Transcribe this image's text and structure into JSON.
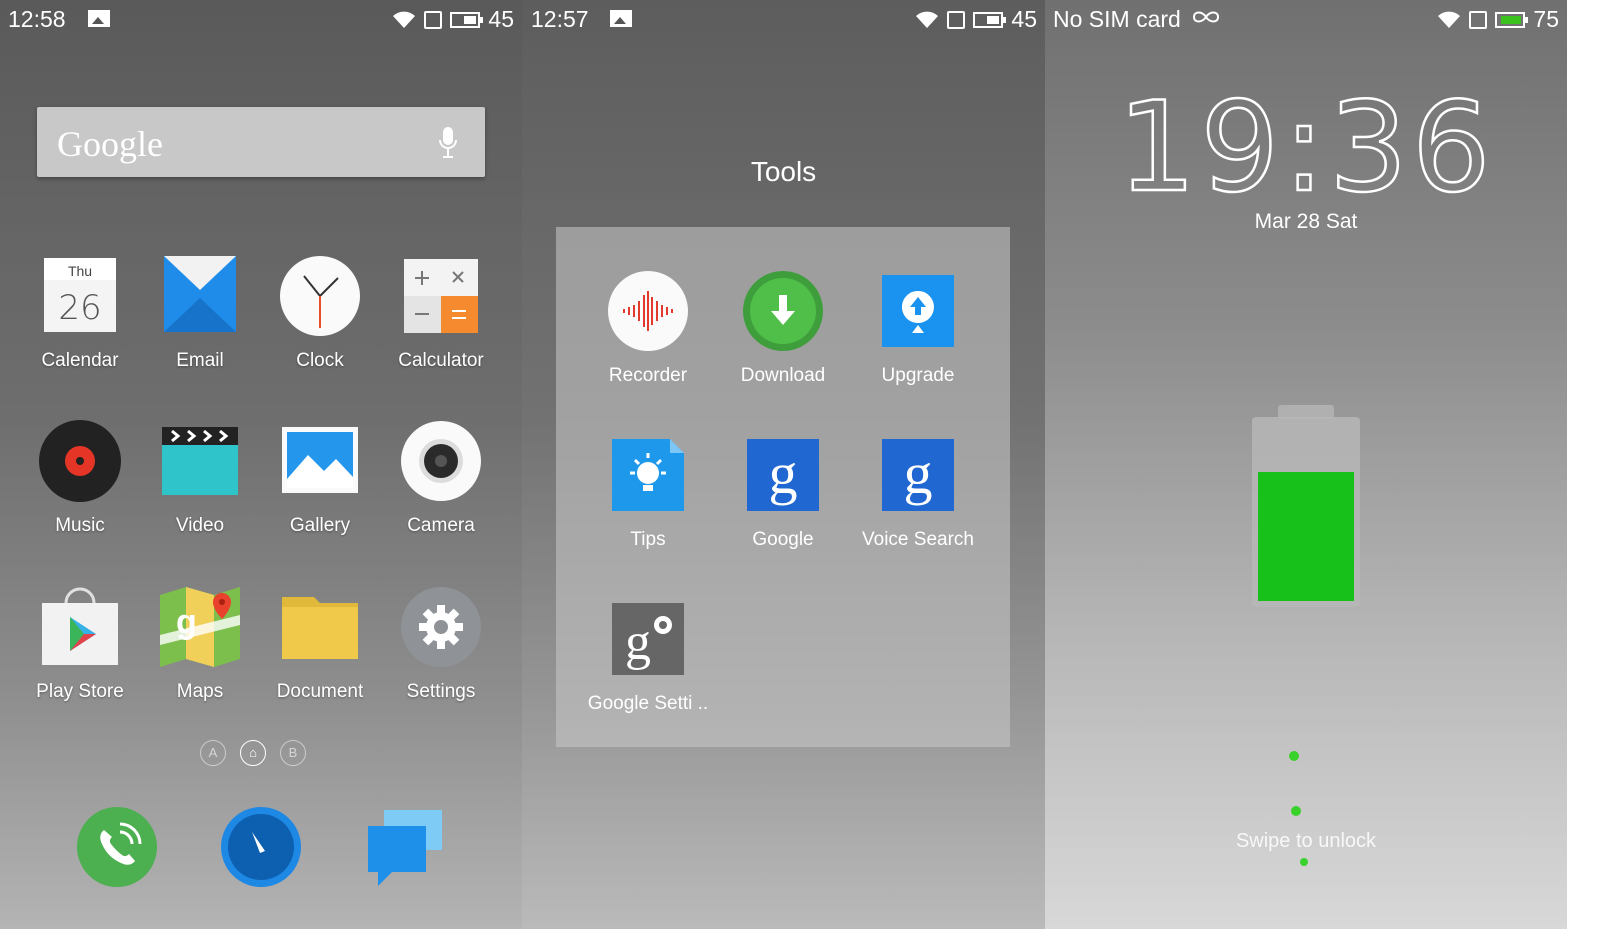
{
  "panel1": {
    "status": {
      "time": "12:58",
      "battery": "45"
    },
    "search": {
      "logo": "Google"
    },
    "apps": [
      {
        "label": "Calendar",
        "icon": "calendar-icon",
        "day": "Thu",
        "date": "26"
      },
      {
        "label": "Email",
        "icon": "email-icon"
      },
      {
        "label": "Clock",
        "icon": "clock-icon"
      },
      {
        "label": "Calculator",
        "icon": "calculator-icon"
      },
      {
        "label": "Music",
        "icon": "music-icon"
      },
      {
        "label": "Video",
        "icon": "video-icon"
      },
      {
        "label": "Gallery",
        "icon": "gallery-icon"
      },
      {
        "label": "Camera",
        "icon": "camera-icon"
      },
      {
        "label": "Play Store",
        "icon": "play-store-icon"
      },
      {
        "label": "Maps",
        "icon": "maps-icon"
      },
      {
        "label": "Document",
        "icon": "document-icon"
      },
      {
        "label": "Settings",
        "icon": "settings-icon"
      }
    ],
    "page_dots": [
      "A",
      "⌂",
      "B"
    ],
    "dock": [
      "phone-icon",
      "browser-icon",
      "messages-icon"
    ]
  },
  "panel2": {
    "status": {
      "time": "12:57",
      "battery": "45"
    },
    "folder": {
      "title": "Tools",
      "apps": [
        {
          "label": "Recorder",
          "icon": "recorder-icon"
        },
        {
          "label": "Download",
          "icon": "download-icon"
        },
        {
          "label": "Upgrade",
          "icon": "upgrade-icon"
        },
        {
          "label": "Tips",
          "icon": "tips-icon"
        },
        {
          "label": "Google",
          "icon": "google-icon"
        },
        {
          "label": "Voice Search",
          "icon": "voice-search-icon"
        },
        {
          "label": "Google Setti ..",
          "icon": "google-settings-icon"
        }
      ]
    }
  },
  "panel3": {
    "status": {
      "carrier": "No SIM card",
      "battery": "75"
    },
    "lock": {
      "time": "19:36",
      "date": "Mar 28  Sat",
      "swipe_text": "Swipe to unlock",
      "battery_level": 0.7
    }
  },
  "colors": {
    "battery_green": "#18c01a",
    "accent_blue": "#1e88e5",
    "dock_green": "#4caf50"
  }
}
